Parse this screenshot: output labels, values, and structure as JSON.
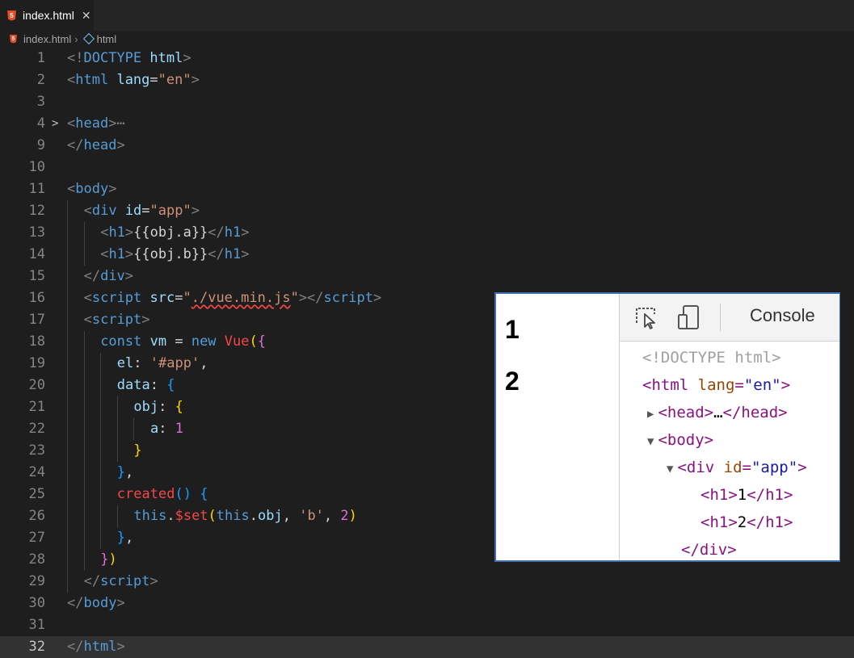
{
  "tab": {
    "filename": "index.html",
    "icon": "html5-icon"
  },
  "breadcrumb": {
    "file": "index.html",
    "node": "html"
  },
  "code_lines": [
    {
      "n": "1",
      "indent": 0,
      "tokens": [
        [
          "p",
          "<!"
        ],
        [
          "t",
          "DOCTYPE"
        ],
        [
          "x",
          " "
        ],
        [
          "a",
          "html"
        ],
        [
          "p",
          ">"
        ]
      ]
    },
    {
      "n": "2",
      "indent": 0,
      "tokens": [
        [
          "p",
          "<"
        ],
        [
          "t",
          "html"
        ],
        [
          "x",
          " "
        ],
        [
          "a",
          "lang"
        ],
        [
          "x",
          "="
        ],
        [
          "s",
          "\"en\""
        ],
        [
          "p",
          ">"
        ]
      ]
    },
    {
      "n": "3",
      "indent": 0,
      "tokens": []
    },
    {
      "n": "4",
      "indent": 0,
      "fold": ">",
      "tokens": [
        [
          "p",
          "<"
        ],
        [
          "t",
          "head"
        ],
        [
          "p",
          ">"
        ],
        [
          "p",
          "⋯"
        ]
      ]
    },
    {
      "n": "9",
      "indent": 0,
      "tokens": [
        [
          "p",
          "</"
        ],
        [
          "t",
          "head"
        ],
        [
          "p",
          ">"
        ]
      ]
    },
    {
      "n": "10",
      "indent": 0,
      "tokens": []
    },
    {
      "n": "11",
      "indent": 0,
      "tokens": [
        [
          "p",
          "<"
        ],
        [
          "t",
          "body"
        ],
        [
          "p",
          ">"
        ]
      ]
    },
    {
      "n": "12",
      "indent": 1,
      "tokens": [
        [
          "p",
          "<"
        ],
        [
          "t",
          "div"
        ],
        [
          "x",
          " "
        ],
        [
          "a",
          "id"
        ],
        [
          "x",
          "="
        ],
        [
          "s",
          "\"app\""
        ],
        [
          "p",
          ">"
        ]
      ]
    },
    {
      "n": "13",
      "indent": 2,
      "tokens": [
        [
          "p",
          "<"
        ],
        [
          "t",
          "h1"
        ],
        [
          "p",
          ">"
        ],
        [
          "x",
          "{{obj.a}}"
        ],
        [
          "p",
          "</"
        ],
        [
          "t",
          "h1"
        ],
        [
          "p",
          ">"
        ]
      ]
    },
    {
      "n": "14",
      "indent": 2,
      "tokens": [
        [
          "p",
          "<"
        ],
        [
          "t",
          "h1"
        ],
        [
          "p",
          ">"
        ],
        [
          "x",
          "{{obj.b}}"
        ],
        [
          "p",
          "</"
        ],
        [
          "t",
          "h1"
        ],
        [
          "p",
          ">"
        ]
      ]
    },
    {
      "n": "15",
      "indent": 1,
      "tokens": [
        [
          "p",
          "</"
        ],
        [
          "t",
          "div"
        ],
        [
          "p",
          ">"
        ]
      ]
    },
    {
      "n": "16",
      "indent": 1,
      "tokens": [
        [
          "p",
          "<"
        ],
        [
          "t",
          "script"
        ],
        [
          "x",
          " "
        ],
        [
          "a",
          "src"
        ],
        [
          "x",
          "="
        ],
        [
          "s",
          "\""
        ],
        [
          "sq",
          "./vue.min.js"
        ],
        [
          "s",
          "\""
        ],
        [
          "p",
          "></"
        ],
        [
          "t",
          "script"
        ],
        [
          "p",
          ">"
        ]
      ]
    },
    {
      "n": "17",
      "indent": 1,
      "tokens": [
        [
          "p",
          "<"
        ],
        [
          "t",
          "script"
        ],
        [
          "p",
          ">"
        ]
      ]
    },
    {
      "n": "18",
      "indent": 2,
      "tokens": [
        [
          "k",
          "const"
        ],
        [
          "x",
          " "
        ],
        [
          "v",
          "vm"
        ],
        [
          "x",
          " = "
        ],
        [
          "k",
          "new"
        ],
        [
          "x",
          " "
        ],
        [
          "r",
          "Vue"
        ],
        [
          "b1",
          "("
        ],
        [
          "b2",
          "{"
        ]
      ]
    },
    {
      "n": "19",
      "indent": 3,
      "tokens": [
        [
          "v",
          "el"
        ],
        [
          "x",
          ": "
        ],
        [
          "s",
          "'#app'"
        ],
        [
          "x",
          ","
        ]
      ]
    },
    {
      "n": "20",
      "indent": 3,
      "tokens": [
        [
          "v",
          "data"
        ],
        [
          "x",
          ": "
        ],
        [
          "b3",
          "{"
        ]
      ]
    },
    {
      "n": "21",
      "indent": 4,
      "tokens": [
        [
          "v",
          "obj"
        ],
        [
          "x",
          ": "
        ],
        [
          "b1",
          "{"
        ]
      ]
    },
    {
      "n": "22",
      "indent": 5,
      "tokens": [
        [
          "v",
          "a"
        ],
        [
          "x",
          ": "
        ],
        [
          "b2",
          "1"
        ]
      ]
    },
    {
      "n": "23",
      "indent": 4,
      "tokens": [
        [
          "b1",
          "}"
        ]
      ]
    },
    {
      "n": "24",
      "indent": 3,
      "tokens": [
        [
          "b3",
          "}"
        ],
        [
          "x",
          ","
        ]
      ]
    },
    {
      "n": "25",
      "indent": 3,
      "tokens": [
        [
          "r",
          "created"
        ],
        [
          "b3",
          "()"
        ],
        [
          "x",
          " "
        ],
        [
          "b3",
          "{"
        ]
      ]
    },
    {
      "n": "26",
      "indent": 4,
      "tokens": [
        [
          "k",
          "this"
        ],
        [
          "x",
          "."
        ],
        [
          "r",
          "$set"
        ],
        [
          "b1",
          "("
        ],
        [
          "k",
          "this"
        ],
        [
          "x",
          "."
        ],
        [
          "v",
          "obj"
        ],
        [
          "x",
          ", "
        ],
        [
          "s",
          "'b'"
        ],
        [
          "x",
          ", "
        ],
        [
          "b2",
          "2"
        ],
        [
          "b1",
          ")"
        ]
      ]
    },
    {
      "n": "27",
      "indent": 3,
      "tokens": [
        [
          "b3",
          "}"
        ],
        [
          "x",
          ","
        ]
      ]
    },
    {
      "n": "28",
      "indent": 2,
      "tokens": [
        [
          "b2",
          "}"
        ],
        [
          "b1",
          ")"
        ]
      ]
    },
    {
      "n": "29",
      "indent": 1,
      "tokens": [
        [
          "p",
          "</"
        ],
        [
          "t",
          "script"
        ],
        [
          "p",
          ">"
        ]
      ]
    },
    {
      "n": "30",
      "indent": 0,
      "tokens": [
        [
          "p",
          "</"
        ],
        [
          "t",
          "body"
        ],
        [
          "p",
          ">"
        ]
      ]
    },
    {
      "n": "31",
      "indent": 0,
      "tokens": []
    },
    {
      "n": "32",
      "indent": 0,
      "active": true,
      "tokens": [
        [
          "p",
          "</"
        ],
        [
          "t",
          "html"
        ],
        [
          "p",
          ">"
        ]
      ]
    }
  ],
  "preview": {
    "headings": [
      "1",
      "2"
    ],
    "devtools": {
      "console_label": "Console",
      "inspect_icon": "select-element-icon",
      "device_icon": "device-toolbar-icon",
      "tree": [
        {
          "indent": 0,
          "tri": "",
          "parts": [
            [
              "doc",
              "<!DOCTYPE html>"
            ]
          ]
        },
        {
          "indent": 0,
          "tri": "",
          "parts": [
            [
              "tag",
              "<html "
            ],
            [
              "attr",
              "lang"
            ],
            [
              "tag",
              "="
            ],
            [
              "val",
              "\"en\""
            ],
            [
              "tag",
              ">"
            ]
          ]
        },
        {
          "indent": 1,
          "tri": "▶",
          "parts": [
            [
              "tag",
              "<head>"
            ],
            [
              "text",
              "…"
            ],
            [
              "tag",
              "</head>"
            ]
          ]
        },
        {
          "indent": 1,
          "tri": "▼",
          "parts": [
            [
              "tag",
              "<body>"
            ]
          ]
        },
        {
          "indent": 2,
          "tri": "▼",
          "parts": [
            [
              "tag",
              "<div "
            ],
            [
              "attr",
              "id"
            ],
            [
              "tag",
              "="
            ],
            [
              "val",
              "\"app\""
            ],
            [
              "tag",
              ">"
            ]
          ]
        },
        {
          "indent": 3,
          "tri": "",
          "parts": [
            [
              "tag",
              "<h1>"
            ],
            [
              "text",
              "1"
            ],
            [
              "tag",
              "</h1>"
            ]
          ]
        },
        {
          "indent": 3,
          "tri": "",
          "parts": [
            [
              "tag",
              "<h1>"
            ],
            [
              "text",
              "2"
            ],
            [
              "tag",
              "</h1>"
            ]
          ]
        },
        {
          "indent": 2,
          "tri": "",
          "parts": [
            [
              "tag",
              "</div>"
            ]
          ]
        }
      ]
    }
  }
}
